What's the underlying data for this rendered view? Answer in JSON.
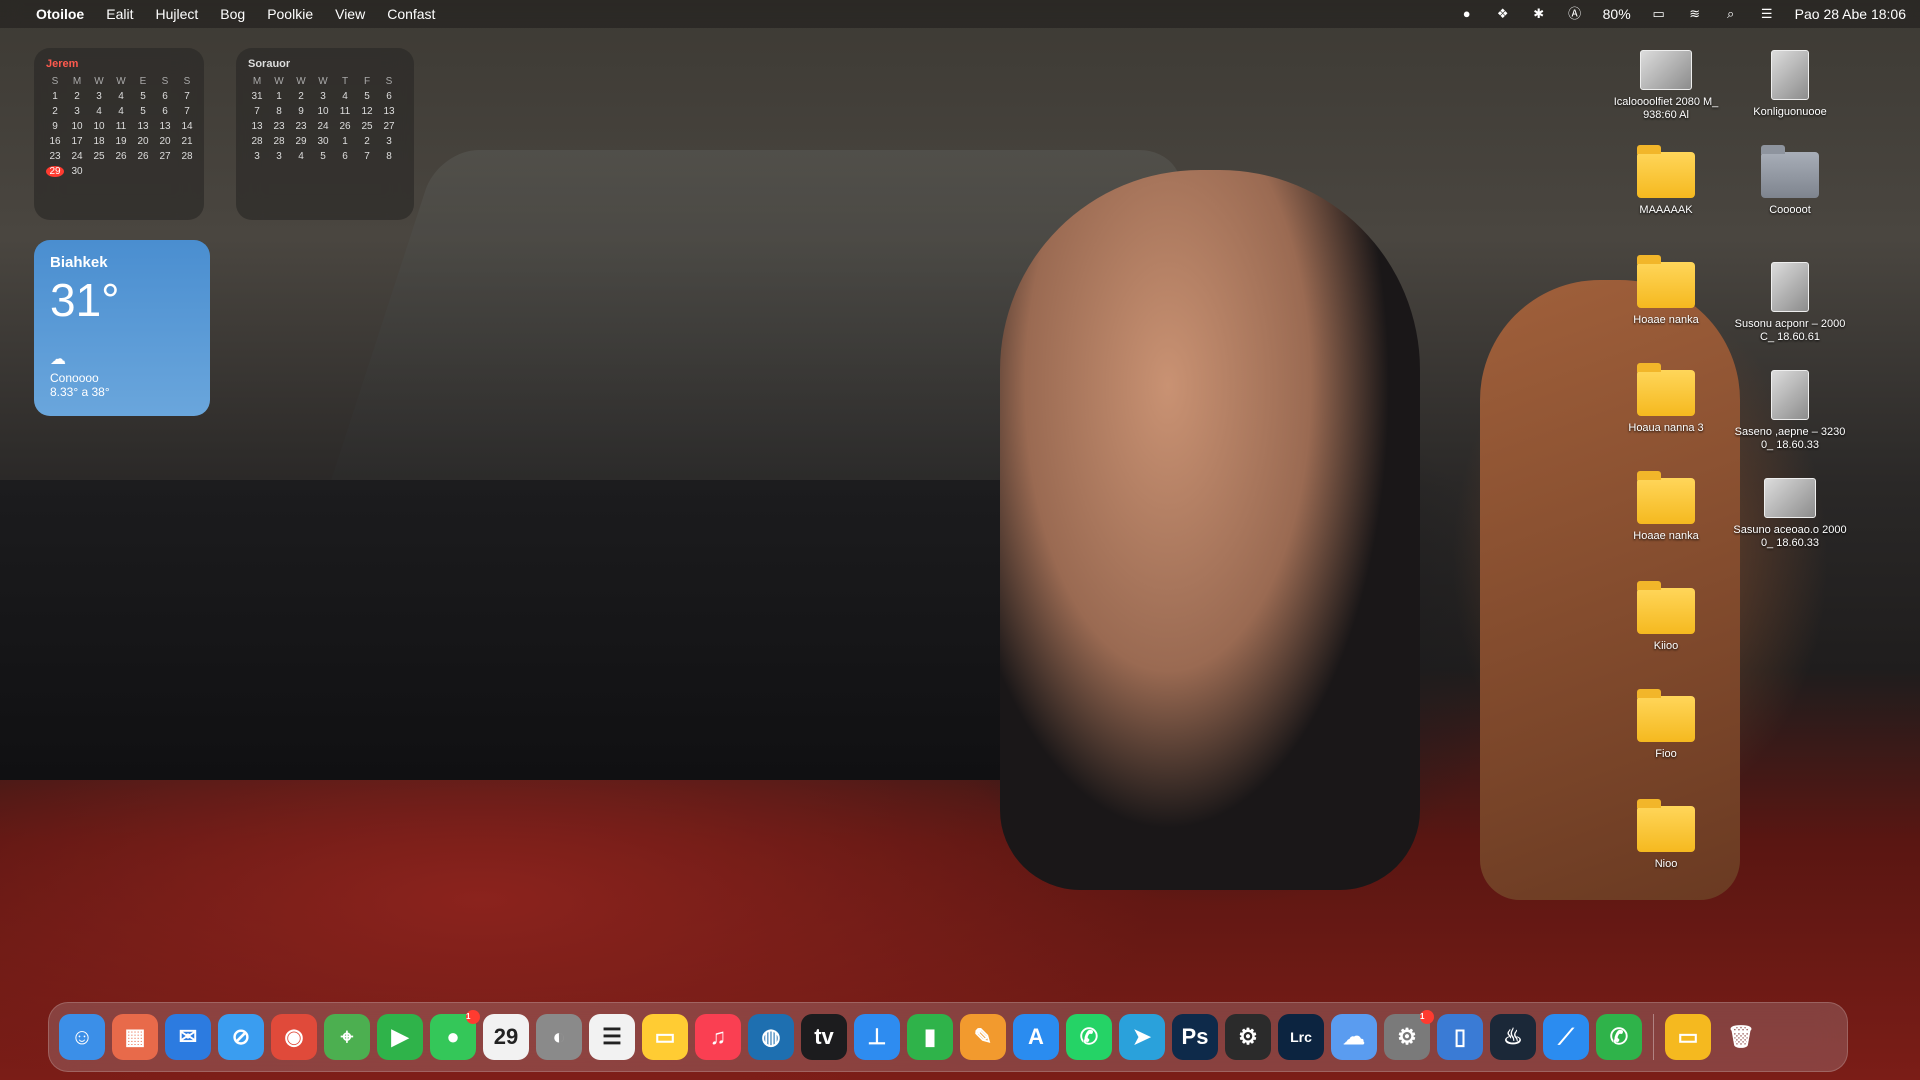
{
  "menubar": {
    "apple_icon": "apple-icon",
    "items": [
      "Otoiloe",
      "Ealit",
      "Hujlect",
      "Bog",
      "Poolkie",
      "View",
      "Confast"
    ],
    "status_icons": [
      "record-icon",
      "extension-icon",
      "bluetooth-icon",
      "keyboard-icon"
    ],
    "battery_percent": "80%",
    "clock": "Pao 28 Abe 18:06"
  },
  "calendar_left": {
    "month": "Jerem",
    "weekdays": [
      "S",
      "M",
      "W",
      "W",
      "E",
      "S",
      "S"
    ],
    "rows": [
      [
        "1",
        "2",
        "3",
        "4",
        "5",
        "6",
        "7"
      ],
      [
        "2",
        "3",
        "4",
        "4",
        "5",
        "6",
        "7"
      ],
      [
        "9",
        "10",
        "10",
        "11",
        "13",
        "13",
        "14"
      ],
      [
        "16",
        "17",
        "18",
        "19",
        "20",
        "20",
        "21"
      ],
      [
        "23",
        "24",
        "25",
        "26",
        "26",
        "27",
        "28"
      ],
      [
        "29",
        "30",
        "",
        "",
        "",
        "",
        ""
      ]
    ],
    "today": "29"
  },
  "calendar_right": {
    "month": "Sorauor",
    "weekdays": [
      "M",
      "W",
      "W",
      "W",
      "T",
      "F",
      "S"
    ],
    "rows": [
      [
        "31",
        "1",
        "2",
        "3",
        "4",
        "5",
        "6"
      ],
      [
        "7",
        "8",
        "9",
        "10",
        "11",
        "12",
        "13"
      ],
      [
        "13",
        "23",
        "23",
        "24",
        "26",
        "25",
        "27"
      ],
      [
        "28",
        "28",
        "29",
        "30",
        "1",
        "2",
        "3"
      ],
      [
        "3",
        "3",
        "4",
        "5",
        "6",
        "7",
        "8"
      ]
    ]
  },
  "weather": {
    "city": "Biahkek",
    "temp": "31°",
    "condition": "Conoooo",
    "range": "8.33° a 38°"
  },
  "desktop_icons": [
    {
      "label": "Icaloooolfiet 2080 M_ 938:60 Al",
      "kind": "thumb"
    },
    {
      "label": "Konliguonuooe",
      "kind": "thumb-tall"
    },
    {
      "label": "MAAAAAK",
      "kind": "folder"
    },
    {
      "label": "Cooooot",
      "kind": "folder-grey"
    },
    {
      "label": "Hoaae nanka",
      "kind": "folder"
    },
    {
      "label": "Susonu acponr – 2000 C_ 18.60.61",
      "kind": "thumb-tall"
    },
    {
      "label": "Hoaua nanna 3",
      "kind": "folder"
    },
    {
      "label": "Saseno ,aepne – 3230 0_ 18.60.33",
      "kind": "thumb-tall"
    },
    {
      "label": "Hoaae nanka",
      "kind": "folder"
    },
    {
      "label": "Sasuno aceoao.o 2000 0_ 18.60.33",
      "kind": "thumb"
    },
    {
      "label": "Kiioo",
      "kind": "folder"
    },
    {
      "label": "Fioo",
      "kind": "folder"
    },
    {
      "label": "Nioo",
      "kind": "folder"
    }
  ],
  "dock": {
    "apps": [
      {
        "name": "finder",
        "glyph": "☺",
        "color": "#3b8fe8"
      },
      {
        "name": "launchpad",
        "glyph": "▦",
        "color": "#e86a4a"
      },
      {
        "name": "mail",
        "glyph": "✉",
        "color": "#2c7be0"
      },
      {
        "name": "safari",
        "glyph": "⊘",
        "color": "#3a9df0"
      },
      {
        "name": "chrome",
        "glyph": "◉",
        "color": "#e04a3a"
      },
      {
        "name": "maps",
        "glyph": "⌖",
        "color": "#4caf50"
      },
      {
        "name": "facetime",
        "glyph": "▶",
        "color": "#2fb34a"
      },
      {
        "name": "messages",
        "glyph": "●",
        "color": "#34c759",
        "badge": "1"
      },
      {
        "name": "calendar",
        "glyph": "29",
        "color": "#f2f2f2"
      },
      {
        "name": "contacts",
        "glyph": "◐",
        "color": "#8a8a8a"
      },
      {
        "name": "reminders",
        "glyph": "☰",
        "color": "#f2f2f2"
      },
      {
        "name": "notes",
        "glyph": "▭",
        "color": "#ffcc33"
      },
      {
        "name": "music",
        "glyph": "♫",
        "color": "#fa3f52"
      },
      {
        "name": "vpn",
        "glyph": "◍",
        "color": "#1e6fb0"
      },
      {
        "name": "tv",
        "glyph": "tv",
        "color": "#1c1c1e"
      },
      {
        "name": "keynote",
        "glyph": "⊥",
        "color": "#2e8cf0"
      },
      {
        "name": "numbers",
        "glyph": "▮",
        "color": "#2fb34a"
      },
      {
        "name": "pages",
        "glyph": "✎",
        "color": "#f29a2e"
      },
      {
        "name": "app-store",
        "glyph": "A",
        "color": "#2a8cf0"
      },
      {
        "name": "whatsapp",
        "glyph": "✆",
        "color": "#25d366"
      },
      {
        "name": "telegram",
        "glyph": "➤",
        "color": "#2aa1db"
      },
      {
        "name": "photoshop",
        "glyph": "Ps",
        "color": "#0e2a4a"
      },
      {
        "name": "openai",
        "glyph": "⚙",
        "color": "#2b2b2b"
      },
      {
        "name": "lightroom",
        "glyph": "Lrc",
        "color": "#0c2440"
      },
      {
        "name": "finder-alt",
        "glyph": "☁",
        "color": "#5a9cf0"
      },
      {
        "name": "system-settings",
        "glyph": "⚙",
        "color": "#7a7a7a",
        "badge": "1"
      },
      {
        "name": "preview",
        "glyph": "▯",
        "color": "#3a7bd5"
      },
      {
        "name": "steam",
        "glyph": "♨",
        "color": "#1b2838"
      },
      {
        "name": "feather",
        "glyph": "⟋",
        "color": "#2b8cf0"
      },
      {
        "name": "phone",
        "glyph": "✆",
        "color": "#2fb34a"
      }
    ],
    "trailing": [
      {
        "name": "downloads-folder",
        "glyph": "▭",
        "color": "#f5b91f"
      },
      {
        "name": "trash",
        "glyph": "🗑",
        "color": "rgba(255,255,255,0)"
      }
    ]
  }
}
